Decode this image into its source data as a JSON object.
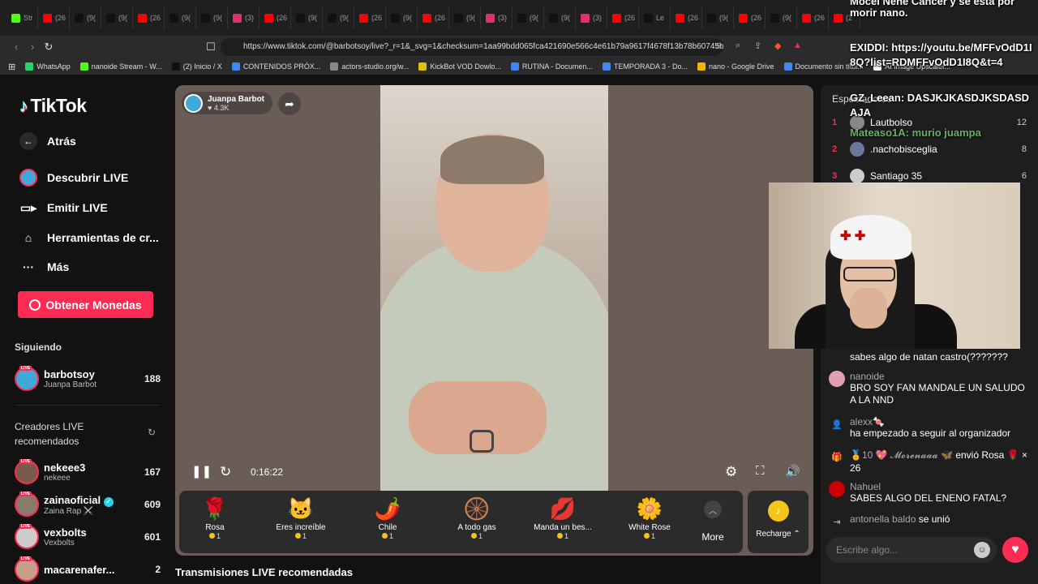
{
  "browser": {
    "tabs": [
      {
        "label": "Str",
        "color": "#53fc18"
      },
      {
        "label": "(26",
        "color": "#ff0000"
      },
      {
        "label": "(9(",
        "color": "#111111"
      },
      {
        "label": "(9(",
        "color": "#111111"
      },
      {
        "label": "(26",
        "color": "#ff0000"
      },
      {
        "label": "(9(",
        "color": "#111111"
      },
      {
        "label": "(9(",
        "color": "#111111"
      },
      {
        "label": "(3)",
        "color": "#e1306c"
      },
      {
        "label": "(26",
        "color": "#ff0000"
      },
      {
        "label": "(9(",
        "color": "#111111"
      },
      {
        "label": "(9(",
        "color": "#111111"
      },
      {
        "label": "(26",
        "color": "#ff0000"
      },
      {
        "label": "(9(",
        "color": "#111111"
      },
      {
        "label": "(26",
        "color": "#ff0000"
      },
      {
        "label": "(9(",
        "color": "#111111"
      },
      {
        "label": "(3)",
        "color": "#e1306c"
      },
      {
        "label": "(9(",
        "color": "#111111"
      },
      {
        "label": "(9(",
        "color": "#111111"
      },
      {
        "label": "(3)",
        "color": "#e1306c"
      },
      {
        "label": "(26",
        "color": "#ff0000"
      },
      {
        "label": "Le",
        "color": "#111111"
      },
      {
        "label": "(26",
        "color": "#ff0000"
      },
      {
        "label": "(9(",
        "color": "#111111"
      },
      {
        "label": "(26",
        "color": "#ff0000"
      },
      {
        "label": "(9(",
        "color": "#111111"
      },
      {
        "label": "(26",
        "color": "#ff0000"
      },
      {
        "label": "(2",
        "color": "#ff0000"
      }
    ],
    "url": "https://www.tiktok.com/@barbotsoy/live?_r=1&_svg=1&checksum=1aa99bdd065fca421690e566c4e61b79a9617f4678f13b78b60745b8b5...",
    "bookmarks": [
      {
        "label": "WhatsApp",
        "color": "#25d366"
      },
      {
        "label": "nanoide Stream - W...",
        "color": "#53fc18"
      },
      {
        "label": "(2) Inicio / X",
        "color": "#111111"
      },
      {
        "label": "CONTENIDOS PRÓX...",
        "color": "#4285f4"
      },
      {
        "label": "actors-studio.org/w...",
        "color": "#888888"
      },
      {
        "label": "KickBot VOD Dowlo...",
        "color": "#e0c200"
      },
      {
        "label": "RUTINA - Documen...",
        "color": "#4285f4"
      },
      {
        "label": "TEMPORADA 3 - Do...",
        "color": "#4285f4"
      },
      {
        "label": "nano - Google Drive",
        "color": "#f4b400"
      },
      {
        "label": "Documento sin títul...",
        "color": "#4285f4"
      },
      {
        "label": "AI Image Upscaler...",
        "color": "#ffffff"
      }
    ]
  },
  "sidebar": {
    "brand": "TikTok",
    "nav": [
      {
        "label": "Atrás",
        "icon": "back-arrow-icon"
      },
      {
        "label": "Descubrir LIVE",
        "icon": "live-avatar-icon"
      },
      {
        "label": "Emitir LIVE",
        "icon": "camera-icon"
      },
      {
        "label": "Herramientas de cr...",
        "icon": "tools-icon"
      },
      {
        "label": "Más",
        "icon": "more-dots-icon"
      }
    ],
    "coins_button": "Obtener Monedas",
    "following_title": "Siguiendo",
    "following": [
      {
        "name": "barbotsoy",
        "sub": "Juanpa Barbot",
        "count": "188",
        "color": "#3fa9d9"
      }
    ],
    "recommended_title_1": "Creadores LIVE",
    "recommended_title_2": "recomendados",
    "recommended": [
      {
        "name": "nekeee3",
        "sub": "nekeee",
        "count": "167",
        "color": "#7a5a4a"
      },
      {
        "name": "zainaoficial",
        "sub": "Zaina Rap ⚔️",
        "count": "609",
        "color": "#8a7a6a"
      },
      {
        "name": "vexbolts",
        "sub": "Vexbolts",
        "count": "601",
        "color": "#cccccc"
      },
      {
        "name": "macarenafer...",
        "sub": "",
        "count": "2",
        "color": "#c4a08a"
      }
    ],
    "live_tag": "LIVE"
  },
  "player": {
    "streamer_name": "Juanpa Barbot",
    "likes": "4.3K",
    "elapsed": "0:16:22",
    "gifts": [
      {
        "name": "Rosa",
        "cost": "1",
        "icon": "🌹"
      },
      {
        "name": "Eres increíble",
        "cost": "1",
        "icon": "🐱"
      },
      {
        "name": "Chile",
        "cost": "1",
        "icon": "🌶️"
      },
      {
        "name": "A todo gas",
        "cost": "1",
        "icon": "🛞"
      },
      {
        "name": "Manda un bes...",
        "cost": "1",
        "icon": "💋"
      },
      {
        "name": "White Rose",
        "cost": "1",
        "icon": "🌼"
      }
    ],
    "more_label": "More",
    "recharge_label": "Recharge ⌃",
    "recommended_below": "Transmisiones LIVE recomendadas"
  },
  "chat": {
    "ranking_title": "Espectadores",
    "ranking": [
      {
        "rank": "1",
        "name": "Lautbolso",
        "score": "12"
      },
      {
        "rank": "2",
        "name": ".nachobisceglia",
        "score": "8"
      },
      {
        "rank": "3",
        "name": "Santiago 35",
        "score": "6"
      }
    ],
    "messages": [
      {
        "nick": "",
        "text": "sabes algo de natan castro(???????",
        "avatar": ""
      },
      {
        "nick": "nanoide",
        "text": "BRO SOY FAN MANDALE UN SALUDO A LA NND",
        "avatar": "#e0a0b0"
      },
      {
        "nick": "alexx🍬",
        "text": "ha empezado a seguir al organizador",
        "avatar": "person-icon"
      },
      {
        "nick": "🏅10 💖 𝓜𝓸𝓻𝓮𝓷𝓪𝓪𝓪 🦋",
        "text": "envió Rosa 🌹 × 26",
        "avatar": "gift-icon"
      },
      {
        "nick": "Nahuel",
        "text": "SABES ALGO DEL ENENO FATAL?",
        "avatar": "#cc0000"
      },
      {
        "nick": "antonella baldo",
        "text": "se unió",
        "avatar": "join-icon"
      }
    ],
    "input_placeholder": "Escribe algo..."
  },
  "overlay": {
    "line1": "Mocel Nene Cancer y se esta por",
    "line2": "morir nano.",
    "line3": "EXIDDI: https://youtu.be/MFFvOdD1I",
    "line4": "8Q?list=RDMFFvOdD1I8Q&t=4",
    "line5": "GZ_Leean: DASJKJKASDJKSDASD",
    "line6": "AJA",
    "line7": "Mateaso1A: murio juampa"
  },
  "colors": {
    "accent": "#fe2c55",
    "coin": "#f5c518",
    "overlay_name": "#7ee07e"
  }
}
